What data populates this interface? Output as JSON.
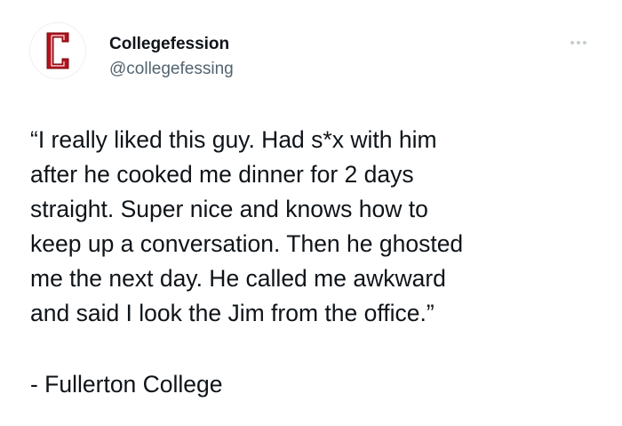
{
  "account": {
    "display_name": "Collegefession",
    "handle": "@collegefessing",
    "avatar_icon": "red-c-logo-icon",
    "avatar_letter": "C",
    "avatar_color": "#b3121d"
  },
  "tweet": {
    "text_lines": [
      "“I really liked this guy. Had s*x with him",
      "after he cooked me dinner for 2 days",
      "straight. Super nice and knows how to",
      "keep up a conversation. Then he ghosted",
      "me the next day. He called me awkward",
      "and said I look the Jim from the office.”"
    ],
    "attribution": "- Fullerton College"
  },
  "menu": {
    "icon": "more-options-icon"
  }
}
